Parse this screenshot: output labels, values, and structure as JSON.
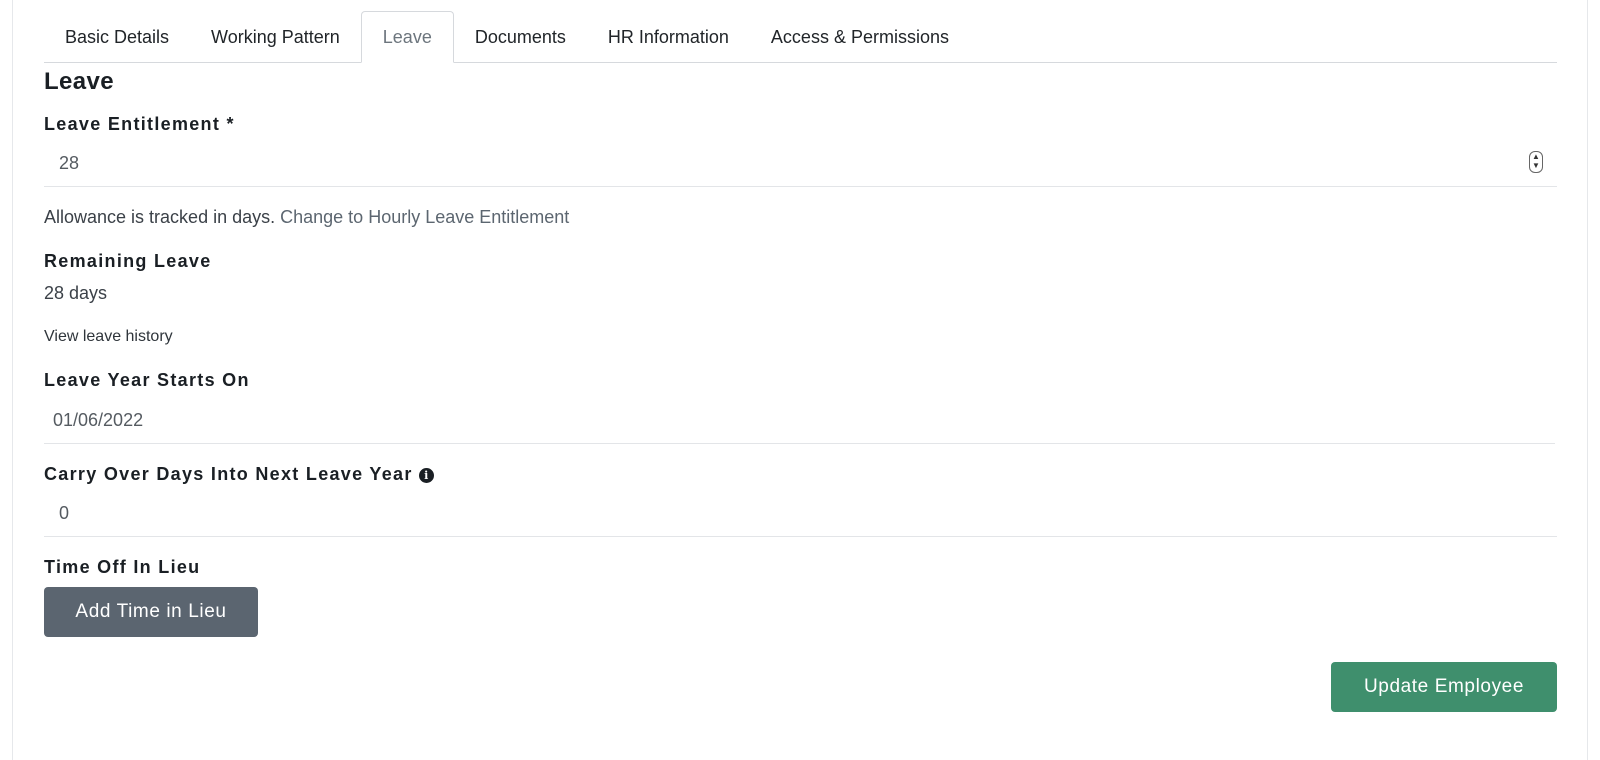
{
  "tabs": [
    {
      "label": "Basic Details",
      "active": false
    },
    {
      "label": "Working Pattern",
      "active": false
    },
    {
      "label": "Leave",
      "active": true
    },
    {
      "label": "Documents",
      "active": false
    },
    {
      "label": "HR Information",
      "active": false
    },
    {
      "label": "Access & Permissions",
      "active": false
    }
  ],
  "section": {
    "title": "Leave"
  },
  "leave_entitlement": {
    "label": "Leave Entitlement *",
    "value": "28"
  },
  "allowance": {
    "text": "Allowance is tracked in days.",
    "link": "Change to Hourly Leave Entitlement"
  },
  "remaining_leave": {
    "label": "Remaining Leave",
    "value": "28 days",
    "history_link": "View leave history"
  },
  "leave_year": {
    "label": "Leave Year Starts On",
    "value": "01/06/2022"
  },
  "carry_over": {
    "label": "Carry Over Days Into Next Leave Year",
    "value": "0",
    "icon": "info-icon"
  },
  "toil": {
    "label": "Time Off In Lieu",
    "button_label": "Add Time in Lieu"
  },
  "actions": {
    "update_label": "Update Employee"
  },
  "colors": {
    "update_button": "#3f8f6d",
    "toil_button": "#5b6570"
  }
}
